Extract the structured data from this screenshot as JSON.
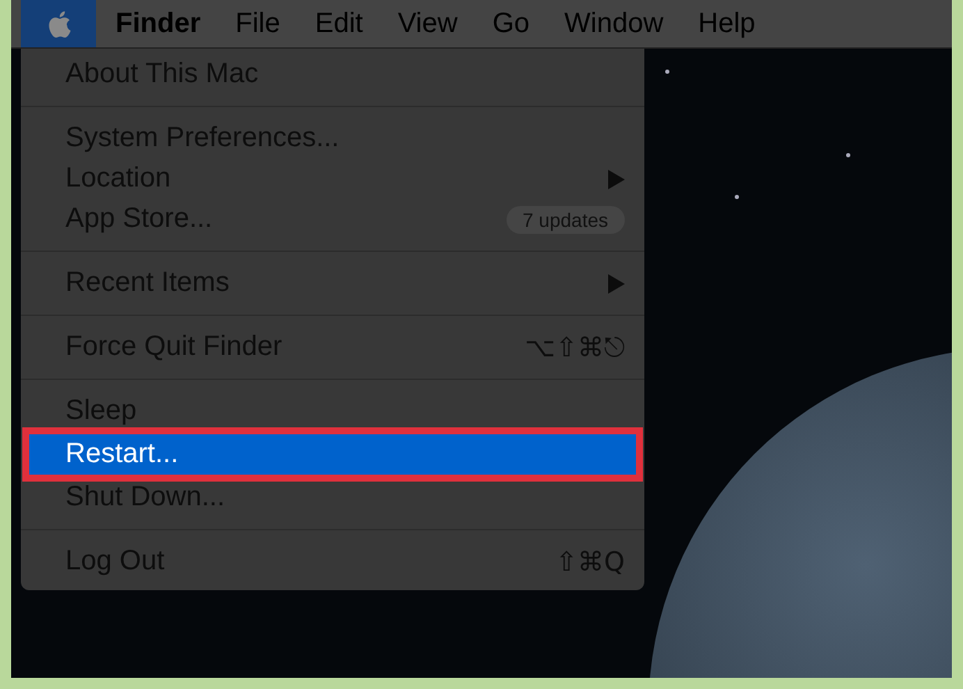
{
  "menu_bar": {
    "apple_menu_open": true,
    "items": [
      {
        "label": "Finder",
        "bold": true
      },
      {
        "label": "File",
        "bold": false
      },
      {
        "label": "Edit",
        "bold": false
      },
      {
        "label": "View",
        "bold": false
      },
      {
        "label": "Go",
        "bold": false
      },
      {
        "label": "Window",
        "bold": false
      },
      {
        "label": "Help",
        "bold": false
      }
    ]
  },
  "apple_menu": {
    "sections": [
      [
        {
          "label": "About This Mac",
          "selected": false
        }
      ],
      [
        {
          "label": "System Preferences...",
          "selected": false
        },
        {
          "label": "Location",
          "selected": false,
          "submenu": true
        },
        {
          "label": "App Store...",
          "selected": false,
          "badge": "7 updates"
        }
      ],
      [
        {
          "label": "Recent Items",
          "selected": false,
          "submenu": true
        }
      ],
      [
        {
          "label": "Force Quit Finder",
          "selected": false,
          "shortcut": "⌥⇧⌘⎋"
        }
      ],
      [
        {
          "label": "Sleep",
          "selected": false
        },
        {
          "label": "Restart...",
          "selected": true
        },
        {
          "label": "Shut Down...",
          "selected": false
        }
      ],
      [
        {
          "label": "Log Out",
          "selected": false,
          "shortcut": "⇧⌘Q"
        }
      ]
    ]
  }
}
